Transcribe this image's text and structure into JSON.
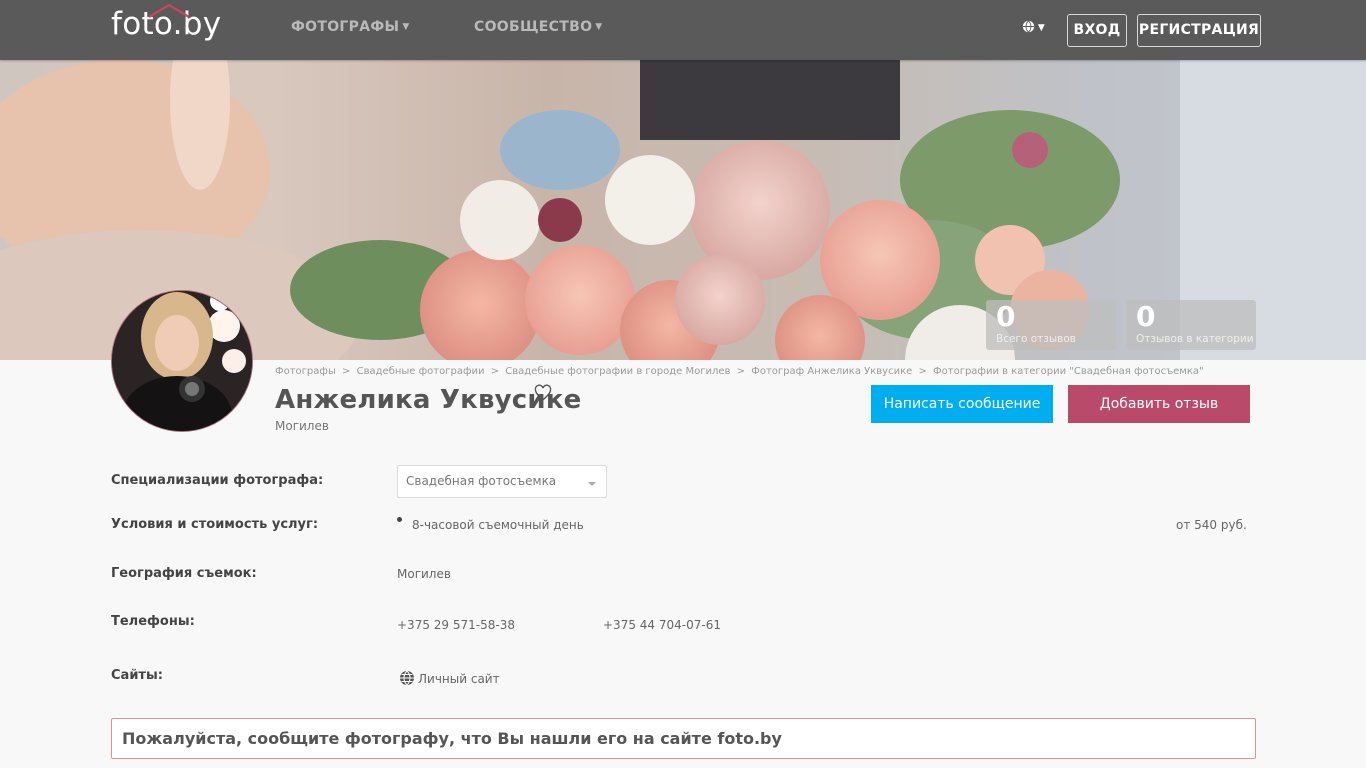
{
  "header": {
    "logo": "foto.by",
    "nav": [
      {
        "label": "ФОТОГРАФЫ"
      },
      {
        "label": "СООБЩЕСТВО"
      }
    ],
    "login_label": "ВХОД",
    "register_label": "РЕГИСТРАЦИЯ"
  },
  "stats": [
    {
      "value": "0",
      "label": "Всего отзывов"
    },
    {
      "value": "0",
      "label": "Отзывов в категории"
    }
  ],
  "breadcrumb": [
    "Фотографы",
    "Свадебные фотографии",
    "Свадебные фотографии в городе Могилев",
    "Фотограф Анжелика Уквусике",
    "Фотографии в категории \"Свадебная фотосъемка\""
  ],
  "breadcrumb_separator": ">",
  "profile": {
    "name": "Анжелика Уквусике",
    "city": "Могилев",
    "message_button": "Написать сообщение",
    "review_button": "Добавить отзыв"
  },
  "details": {
    "specializations_label": "Специализации фотографа:",
    "specialization_selected": "Свадебная фотосъемка",
    "services_label": "Условия и стоимость услуг:",
    "service_name": "8-часовой съемочный день",
    "service_price": "от 540 руб.",
    "geography_label": "География съемок:",
    "geography_value": "Могилев",
    "phones_label": "Телефоны:",
    "phones": [
      "+375 29 571-58-38",
      "+375 44 704-07-61"
    ],
    "sites_label": "Сайты:",
    "site_link": "Личный сайт"
  },
  "notice": "Пожалуйста, сообщите фотографу, что Вы нашли его на сайте foto.by",
  "colors": {
    "topbar": "#5a5a5a",
    "message_button": "#00aef0",
    "review_button": "#b94a6a",
    "notice_border": "#e58f95"
  }
}
